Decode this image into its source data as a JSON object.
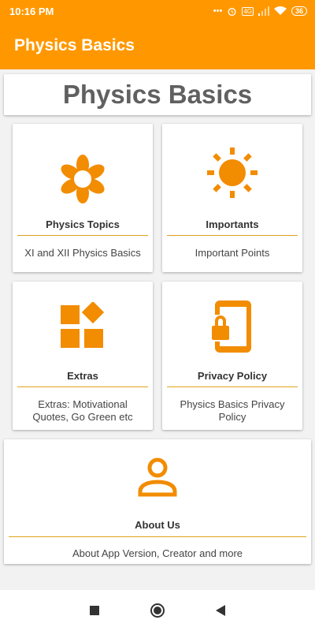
{
  "status": {
    "time": "10:16 PM",
    "network": "4G",
    "battery": "36"
  },
  "app_bar": {
    "title": "Physics Basics"
  },
  "header": {
    "title": "Physics Basics"
  },
  "cards": [
    {
      "title": "Physics Topics",
      "desc": "XI and XII Physics Basics",
      "icon": "flower-icon"
    },
    {
      "title": "Importants",
      "desc": "Important Points",
      "icon": "sun-icon"
    },
    {
      "title": "Extras",
      "desc": "Extras: Motivational Quotes, Go Green etc",
      "icon": "widgets-icon"
    },
    {
      "title": "Privacy Policy",
      "desc": "Physics Basics Privacy Policy",
      "icon": "phone-lock-icon"
    },
    {
      "title": "About Us",
      "desc": "About App Version, Creator and more",
      "icon": "person-icon"
    }
  ],
  "colors": {
    "accent": "#ff9800",
    "icon": "#f28c00",
    "divider": "#e0a31a"
  }
}
